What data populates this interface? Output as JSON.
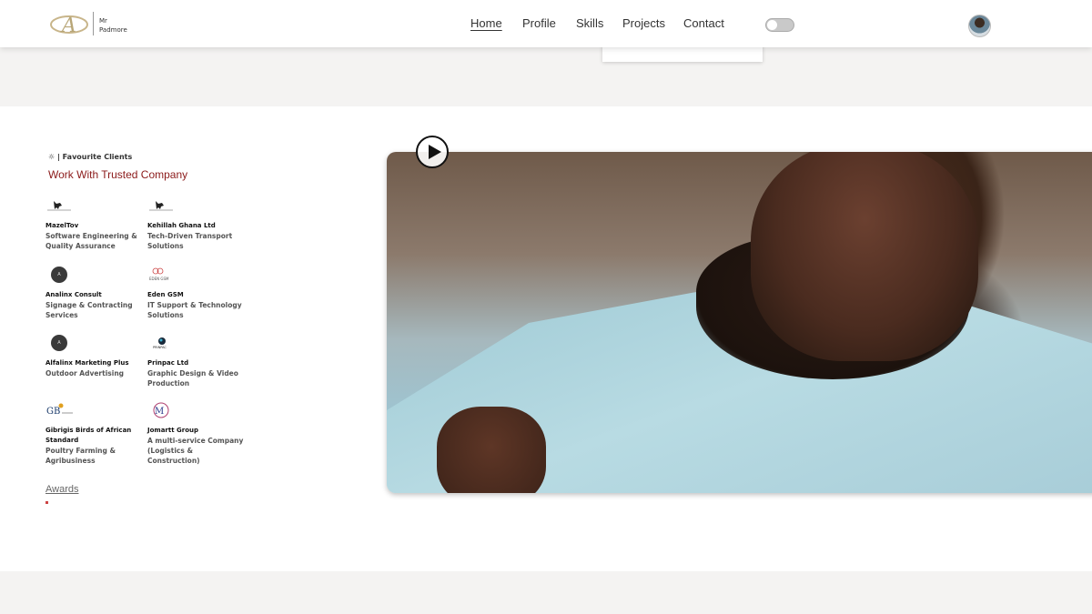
{
  "header": {
    "logo_line1": "Mr",
    "logo_line2": "Padmore",
    "nav": {
      "home": "Home",
      "profile": "Profile",
      "skills": "Skills",
      "projects": "Projects",
      "contact": "Contact"
    },
    "theme_toggle_state": "off"
  },
  "clients_section": {
    "eyebrow": "Favourite Clients",
    "eyebrow_icon": "gear-icon",
    "heading": "Work With Trusted Company",
    "heading_color": "#8b1a1a",
    "clients": [
      {
        "name": "MazelTov",
        "desc": "Software Engineering & Quality Assurance",
        "logo": "horse-logo"
      },
      {
        "name": "Kehillah Ghana Ltd",
        "desc": "Tech-Driven Transport Solutions",
        "logo": "horse-logo"
      },
      {
        "name": "Analinx Consult",
        "desc": "Signage & Contracting Services",
        "logo": "dark-circle-logo"
      },
      {
        "name": "Eden GSM",
        "desc": "IT Support & Technology Solutions",
        "logo": "eden-gsm-logo"
      },
      {
        "name": "Alfalinx Marketing Plus",
        "desc": "Outdoor Advertising",
        "logo": "dark-circle-logo"
      },
      {
        "name": "Prinpac Ltd",
        "desc": "Graphic Design & Video Production",
        "logo": "prinpac-logo"
      },
      {
        "name": "Gibrigis Birds of African Standard",
        "desc": "Poultry Farming & Agribusiness",
        "logo": "gb-logo"
      },
      {
        "name": "Jomartt Group",
        "desc": "A multi-service Company (Logistics & Construction)",
        "logo": "jm-logo"
      }
    ],
    "awards_link": "Awards"
  },
  "video": {
    "play_icon": "play-icon"
  }
}
